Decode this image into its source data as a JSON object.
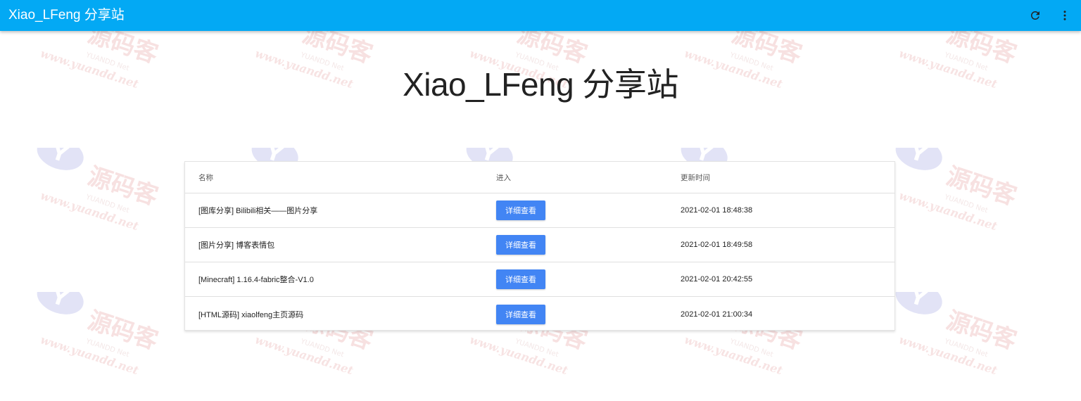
{
  "appbar": {
    "title": "Xiao_LFeng 分享站",
    "refresh_icon": "refresh-icon",
    "more_icon": "more-vert-icon",
    "color": "#03a9f4"
  },
  "hero": {
    "title": "Xiao_LFeng 分享站"
  },
  "table": {
    "headers": {
      "name": "名称",
      "enter": "进入",
      "updated": "更新时间"
    },
    "rows": [
      {
        "name": "[图库分享] Bilibili相关——图片分享",
        "button": "详细查看",
        "updated": "2021-02-01 18:48:38"
      },
      {
        "name": "[图片分享] 博客表情包",
        "button": "详细查看",
        "updated": "2021-02-01 18:49:58"
      },
      {
        "name": "[Minecraft] 1.16.4-fabric整合-V1.0",
        "button": "详细查看",
        "updated": "2021-02-01 20:42:55"
      },
      {
        "name": "[HTML源码] xiaolfeng主页源码",
        "button": "详细查看",
        "updated": "2021-02-01 21:00:34"
      }
    ],
    "button_color": "#4285f4"
  },
  "watermark": {
    "text": "源码客",
    "url": "www.yuandd.net",
    "sub": "YUANDD Net"
  }
}
